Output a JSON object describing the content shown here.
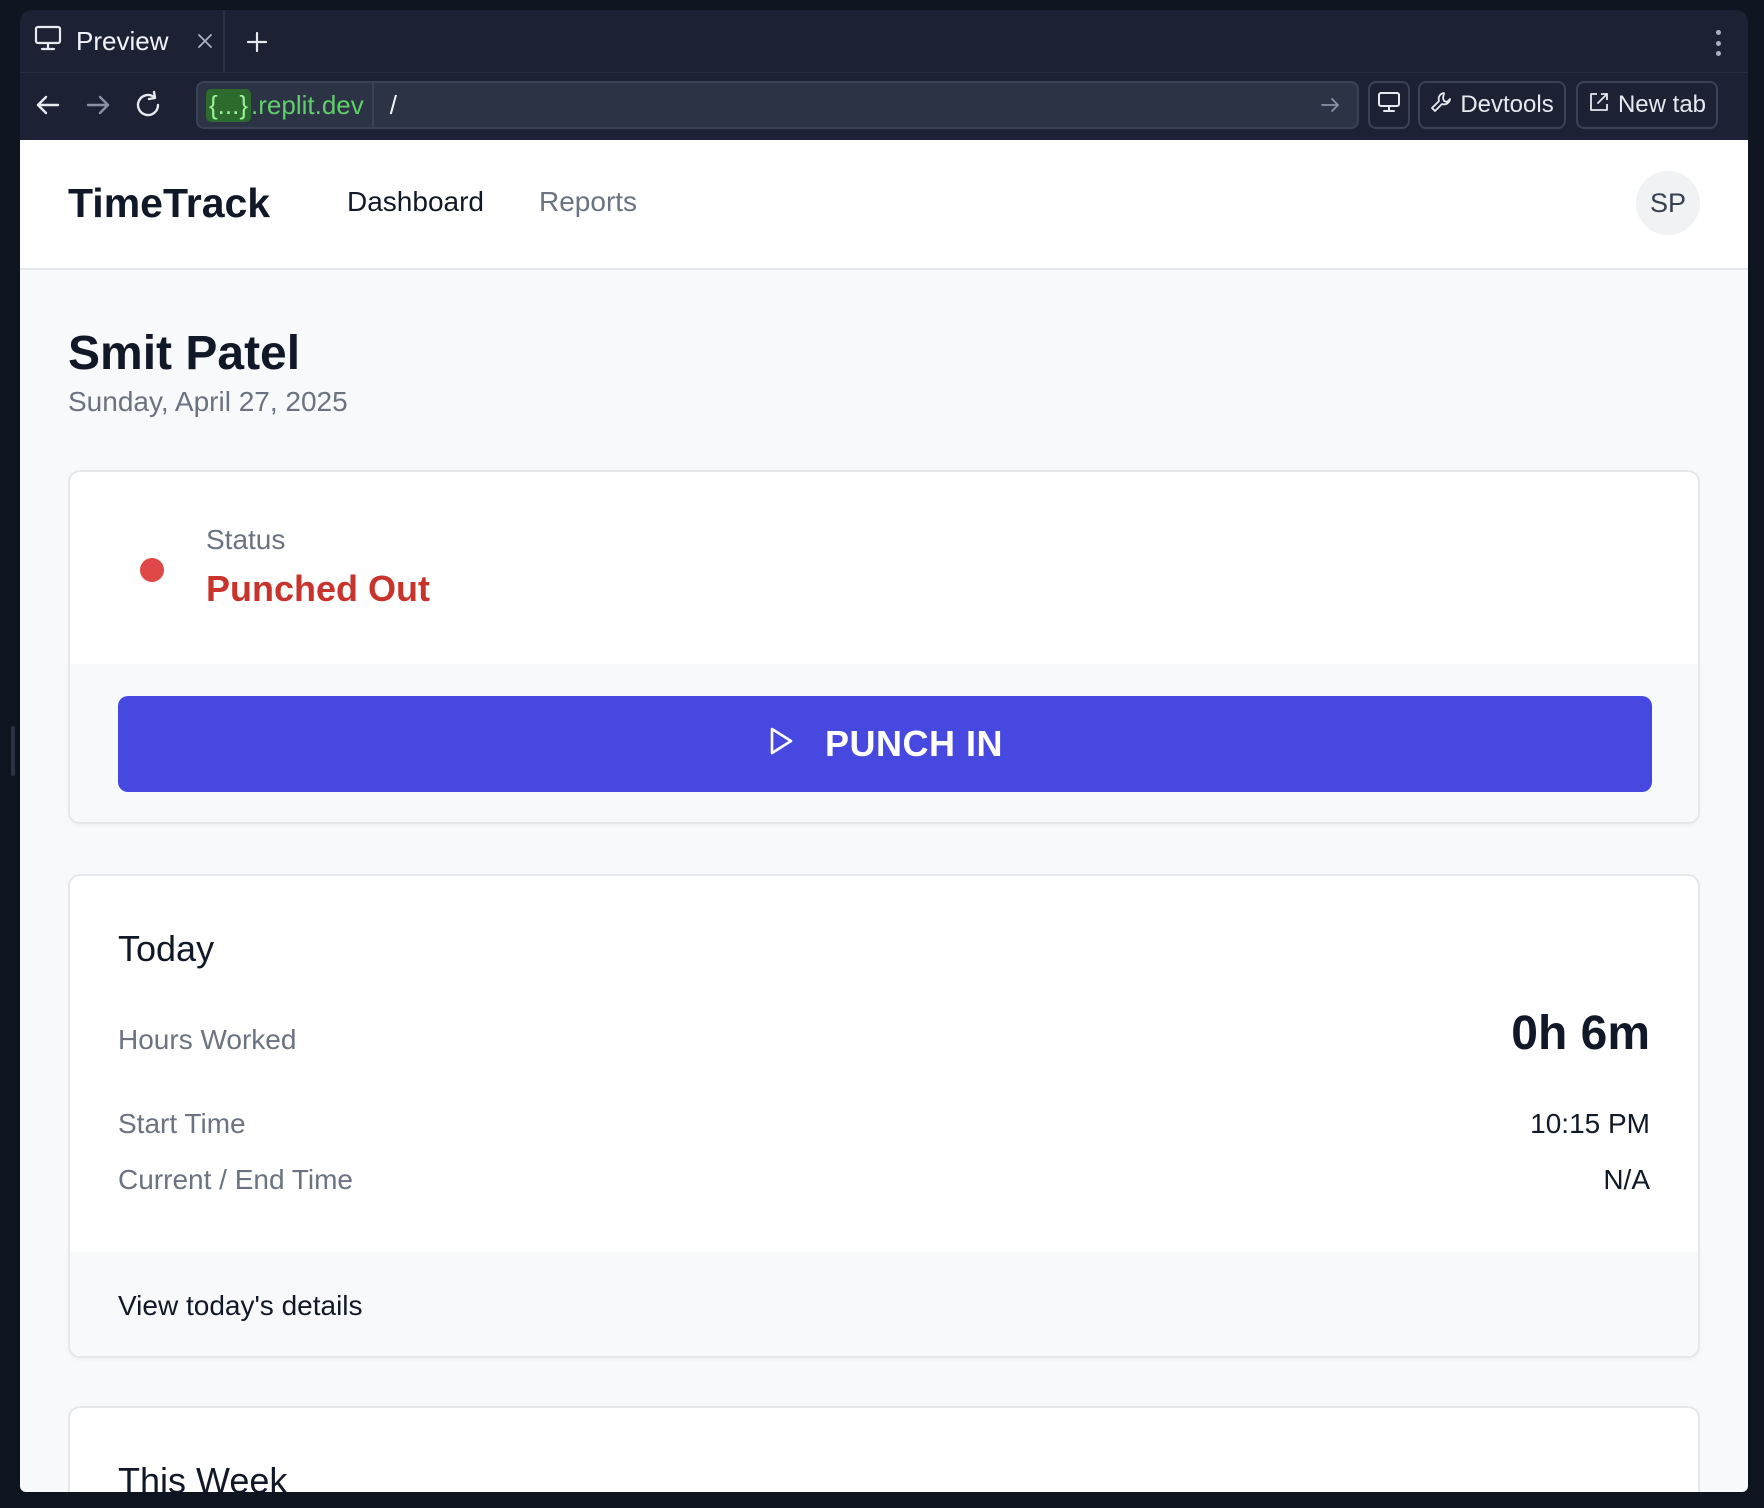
{
  "browser": {
    "tab_title": "Preview",
    "url_host_highlight": "{...}",
    "url_host_rest": ".replit.dev",
    "url_path": "/",
    "devtools_label": "Devtools",
    "new_tab_label": "New tab"
  },
  "header": {
    "brand": "TimeTrack",
    "nav": [
      {
        "label": "Dashboard",
        "active": true
      },
      {
        "label": "Reports",
        "active": false
      }
    ],
    "avatar_initials": "SP"
  },
  "user": {
    "name": "Smit Patel",
    "date": "Sunday, April 27, 2025"
  },
  "status_card": {
    "label": "Status",
    "value": "Punched Out",
    "indicator_color": "#e04848",
    "punch_button_label": "PUNCH IN",
    "punch_button_color": "#4748e0"
  },
  "today": {
    "title": "Today",
    "rows": [
      {
        "label": "Hours Worked",
        "value": "0h 6m"
      },
      {
        "label": "Start Time",
        "value": "10:15 PM"
      },
      {
        "label": "Current / End Time",
        "value": "N/A"
      }
    ],
    "details_link": "View today's details"
  },
  "week": {
    "title": "This Week"
  }
}
